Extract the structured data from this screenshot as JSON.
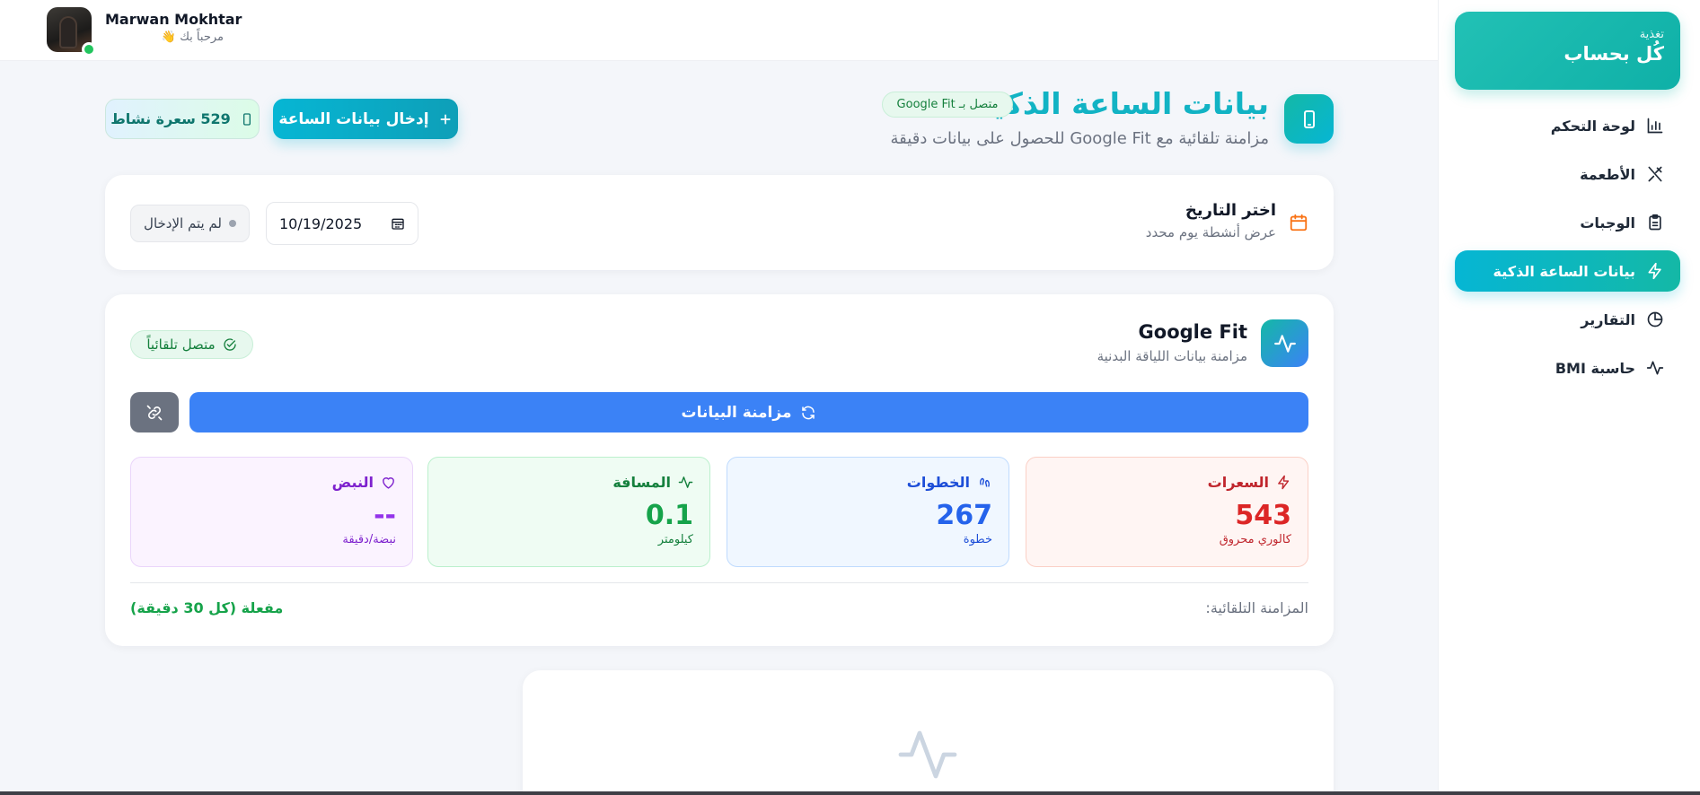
{
  "sidebar": {
    "brand": {
      "subtitle": "تغذية",
      "title": "كُل بحساب"
    },
    "items": [
      {
        "label": "لوحة التحكم",
        "icon": "bar-chart-icon",
        "active": false
      },
      {
        "label": "الأطعمة",
        "icon": "utensils-icon",
        "active": false
      },
      {
        "label": "الوجبات",
        "icon": "clipboard-icon",
        "active": false
      },
      {
        "label": "بيانات الساعة الذكية",
        "icon": "bolt-icon",
        "active": true
      },
      {
        "label": "التقارير",
        "icon": "pie-chart-icon",
        "active": false
      },
      {
        "label": "حاسبة BMI",
        "icon": "activity-icon",
        "active": false
      }
    ]
  },
  "user": {
    "name": "Marwan Mokhtar",
    "greeting": "مرحباً بك 👋"
  },
  "header": {
    "title": "بيانات الساعة الذكية",
    "badge": "متصل بـ Google Fit",
    "subtitle": "مزامنة تلقائية مع Google Fit للحصول على بيانات دقيقة",
    "enter_button": "إدخال بيانات الساعة",
    "activity_pill": "529 سعرة نشاط"
  },
  "date_card": {
    "label": "اختر التاريخ",
    "hint": "عرض أنشطة يوم محدد",
    "date_value": "10/19/2025",
    "status": "لم يتم الإدخال"
  },
  "google_fit": {
    "title": "Google Fit",
    "subtitle": "مزامنة بيانات اللياقة البدنية",
    "connected": "متصل تلقائياً",
    "sync_button": "مزامنة البيانات",
    "stats": {
      "calories": {
        "label": "السعرات",
        "value": "543",
        "unit": "كالوري محروق"
      },
      "steps": {
        "label": "الخطوات",
        "value": "267",
        "unit": "خطوة"
      },
      "distance": {
        "label": "المسافة",
        "value": "0.1",
        "unit": "كيلومتر"
      },
      "pulse": {
        "label": "النبض",
        "value": "--",
        "unit": "نبضة/دقيقة"
      }
    },
    "auto_sync_label": "المزامنة التلقائية:",
    "auto_sync_value": "مفعلة (كل 30 دقيقة)"
  },
  "colors": {
    "accent": "#06b6d4",
    "teal": "#14b8a6",
    "sync_blue": "#3b82f6"
  }
}
